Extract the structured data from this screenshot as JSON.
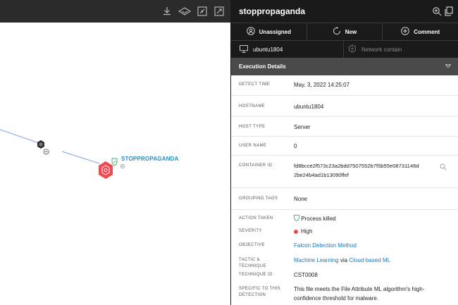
{
  "graph": {
    "toolbar_icons": [
      "download-icon",
      "layers-icon",
      "collapse-icon",
      "expand-icon"
    ],
    "node_label": "STOPPROPAGANDA",
    "colors": {
      "edge": "#7fa3e0",
      "detection_node": "#ef4a52",
      "parent_node": "#2d2d2d",
      "label": "#1f8fc9"
    }
  },
  "panel": {
    "title": "stoppropaganda",
    "header_icons": [
      "search-zoom-icon",
      "copy-icon"
    ],
    "actions": [
      {
        "label": "Unassigned",
        "icon": "user-icon"
      },
      {
        "label": "New",
        "icon": "status-cycle-icon"
      },
      {
        "label": "Comment",
        "icon": "plus-circle-icon"
      }
    ],
    "host": {
      "label": "ubuntu1804",
      "icon": "monitor-icon"
    },
    "network_contain": {
      "label": "Network contain",
      "icon": "network-icon"
    },
    "section_title": "Execution Details",
    "details": {
      "detect_time": {
        "key": "DETECT TIME",
        "value": "May. 3, 2022 14:25:07"
      },
      "hostname": {
        "key": "HOSTNAME",
        "value": "ubuntu1804"
      },
      "host_type": {
        "key": "HOST TYPE",
        "value": "Server"
      },
      "user_name": {
        "key": "USER NAME",
        "value": "0"
      },
      "container_id": {
        "key": "CONTAINER ID",
        "value_line1": "fd8bcce2f573c23a2bdd7507552b7f5b55e08731146d",
        "value_line2": "2be24b4ad1b13090ffef"
      },
      "grouping_tags": {
        "key": "GROUPING TAGS",
        "value": "None"
      },
      "action_taken": {
        "key": "ACTION TAKEN",
        "value": "Process killed"
      },
      "severity": {
        "key": "SEVERITY",
        "value": "High"
      },
      "objective": {
        "key": "OBJECTIVE",
        "value": "Falcon Detection Method"
      },
      "tactic": {
        "key": "TACTIC & TECHNIQUE",
        "tactic": "Machine Learning",
        "joiner": "via",
        "technique": "Cloud-based ML"
      },
      "technique_id": {
        "key": "TECHNIQUE ID",
        "value": "CST0008"
      },
      "specific": {
        "key": "SPECIFIC TO THIS DETECTION",
        "value_line1": "This file meets the File Attribute ML algorithm's high-",
        "value_line2": "confidence threshold for malware."
      }
    },
    "colors": {
      "dark_bg": "#1a1a1a",
      "section_bg": "#4a4a4a",
      "link": "#1b78b8",
      "severity_high": "#ea4c4c",
      "ok_green": "#3dab6b"
    }
  }
}
